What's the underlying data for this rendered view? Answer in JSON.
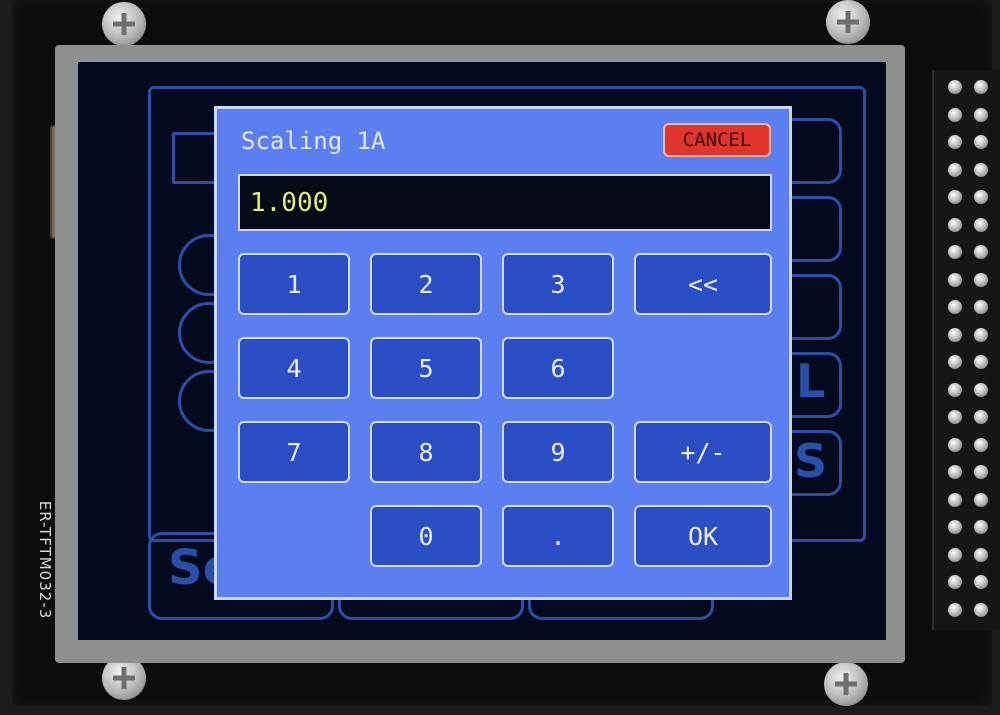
{
  "device": {
    "pcb_label": "ER-TFTM032-3"
  },
  "background_screen": {
    "partial_label": "Se",
    "right_letters": [
      "L",
      "S"
    ]
  },
  "keypad_dialog": {
    "title": "Scaling 1A",
    "cancel_label": "CANCEL",
    "value": "1.000",
    "keys": {
      "k1": "1",
      "k2": "2",
      "k3": "3",
      "backspace": "<<",
      "k4": "4",
      "k5": "5",
      "k6": "6",
      "k7": "7",
      "k8": "8",
      "k9": "9",
      "sign": "+/-",
      "k0": "0",
      "decimal": ".",
      "ok": "OK"
    }
  },
  "colors": {
    "dialog_bg": "#5b7ff0",
    "key_bg": "#2c4ec4",
    "cancel_bg": "#e0352b",
    "value_text": "#e5ef6a",
    "screen_bg": "#030a1e"
  }
}
